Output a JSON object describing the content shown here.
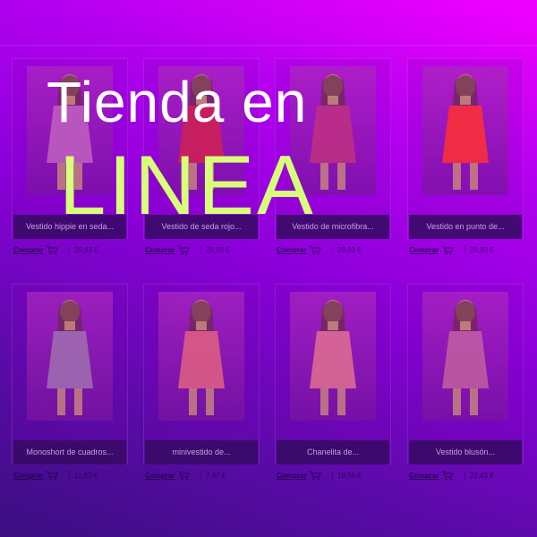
{
  "headline": {
    "line1": "Tienda en",
    "line2": "LINEA"
  },
  "colors": {
    "line1": "#ffffff",
    "line2": "#d8ff7a",
    "overlay_top": "#f200ff",
    "overlay_bottom": "#3a0e80"
  },
  "products": [
    {
      "caption": "Vestido hippie en seda...",
      "buy_label": "Comprar",
      "price": "29,93 €",
      "dress": "#c060c0"
    },
    {
      "caption": "Vestido de seda rojo...",
      "buy_label": "Comprar",
      "price": "29,93 €",
      "dress": "#d02050"
    },
    {
      "caption": "Vestido de microfibra...",
      "buy_label": "Comprar",
      "price": "29,93 €",
      "dress": "#c03080"
    },
    {
      "caption": "Vestido en punto de...",
      "buy_label": "Comprar",
      "price": "29,93 €",
      "dress": "#ff3030"
    },
    {
      "caption": "Monoshort de cuadros...",
      "buy_label": "Comprar",
      "price": "11,83 €",
      "dress": "#a070b0"
    },
    {
      "caption": "minivestido de...",
      "buy_label": "Comprar",
      "price": "7,47 €",
      "dress": "#e06080"
    },
    {
      "caption": "Chanelita de...",
      "buy_label": "Comprar",
      "price": "19,50 €",
      "dress": "#e07090"
    },
    {
      "caption": "Vestido blusón...",
      "buy_label": "Comprar",
      "price": "22,43 €",
      "dress": "#c060a0"
    }
  ]
}
